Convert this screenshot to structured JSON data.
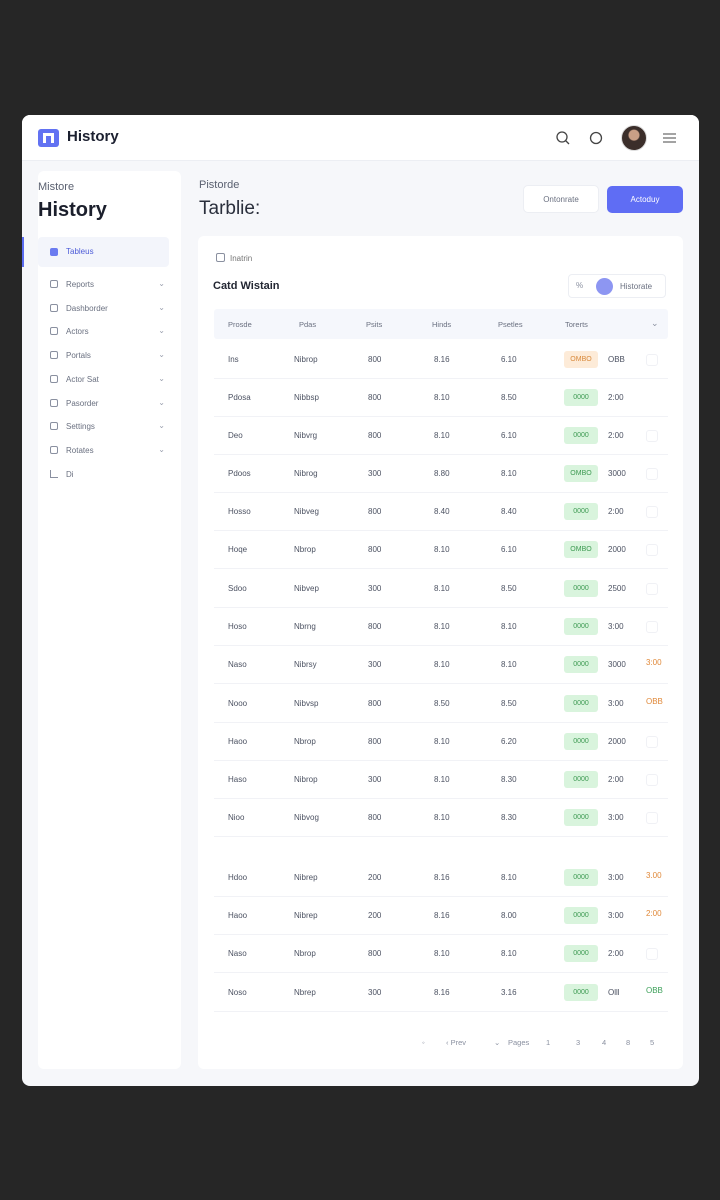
{
  "header": {
    "app_title": "History"
  },
  "sidebar": {
    "subtitle": "Mistore",
    "title": "History",
    "active_item": "Tableus",
    "items": [
      {
        "label": "Reports"
      },
      {
        "label": "Dashborder"
      },
      {
        "label": "Actors"
      },
      {
        "label": "Portals"
      },
      {
        "label": "Actor Sat"
      },
      {
        "label": "Pasorder"
      },
      {
        "label": "Settings"
      },
      {
        "label": "Rotates"
      }
    ],
    "footer_item": "Di"
  },
  "main": {
    "subtitle": "Pistorde",
    "title": "Tarblie:",
    "btn_secondary": "Ontonrate",
    "btn_primary": "Actoduy"
  },
  "card": {
    "search_placeholder": "Inatrin",
    "title": "Catd Wistain",
    "filter_icon": "%",
    "filter_label": "Historate"
  },
  "table": {
    "headers": [
      "Prosde",
      "Pdas",
      "Psits",
      "Hinds",
      "Psetles",
      "Torerts"
    ],
    "rows": [
      {
        "c1": "Ins",
        "c2": "Nibrop",
        "c3": "800",
        "c4": "8.16",
        "c5": "6.10",
        "status": "OMBO",
        "status_color": "orange",
        "value": "OBB",
        "extra": "",
        "extra_style": "box"
      },
      {
        "c1": "Pdosa",
        "c2": "Nibbsp",
        "c3": "800",
        "c4": "8.10",
        "c5": "8.50",
        "status": "0000",
        "status_color": "green",
        "value": "2:00",
        "extra": "",
        "extra_style": "none"
      },
      {
        "c1": "Deo",
        "c2": "Nibvrg",
        "c3": "800",
        "c4": "8.10",
        "c5": "6.10",
        "status": "0000",
        "status_color": "green",
        "value": "2:00",
        "extra": "",
        "extra_style": "box"
      },
      {
        "c1": "Pdoos",
        "c2": "Nibrog",
        "c3": "300",
        "c4": "8.80",
        "c5": "8.10",
        "status": "OMBO",
        "status_color": "green",
        "value": "3000",
        "extra": "",
        "extra_style": "box"
      },
      {
        "c1": "Hosso",
        "c2": "Nibveg",
        "c3": "800",
        "c4": "8.40",
        "c5": "8.40",
        "status": "0000",
        "status_color": "green",
        "value": "2:00",
        "extra": "",
        "extra_style": "box"
      },
      {
        "c1": "Hoqe",
        "c2": "Nbrop",
        "c3": "800",
        "c4": "8.10",
        "c5": "6.10",
        "status": "OMBO",
        "status_color": "green",
        "value": "2000",
        "extra": "",
        "extra_style": "box"
      },
      {
        "c1": "Sdoo",
        "c2": "Nibvep",
        "c3": "300",
        "c4": "8.10",
        "c5": "8.50",
        "status": "0000",
        "status_color": "green",
        "value": "2500",
        "extra": "",
        "extra_style": "box"
      },
      {
        "c1": "Hoso",
        "c2": "Nbrng",
        "c3": "800",
        "c4": "8.10",
        "c5": "8.10",
        "status": "0000",
        "status_color": "green",
        "value": "3:00",
        "extra": "",
        "extra_style": "box"
      },
      {
        "c1": "Naso",
        "c2": "Nibrsy",
        "c3": "300",
        "c4": "8.10",
        "c5": "8.10",
        "status": "0000",
        "status_color": "green",
        "value": "3000",
        "extra": "3:00",
        "extra_style": "orange"
      },
      {
        "c1": "Nooo",
        "c2": "Nibvsp",
        "c3": "800",
        "c4": "8.50",
        "c5": "8.50",
        "status": "0000",
        "status_color": "green",
        "value": "3:00",
        "extra": "OBB",
        "extra_style": "orange"
      },
      {
        "c1": "Haoo",
        "c2": "Nbrop",
        "c3": "800",
        "c4": "8.10",
        "c5": "6.20",
        "status": "0000",
        "status_color": "green",
        "value": "2000",
        "extra": "",
        "extra_style": "box"
      },
      {
        "c1": "Haso",
        "c2": "Nibrop",
        "c3": "300",
        "c4": "8.10",
        "c5": "8.30",
        "status": "0000",
        "status_color": "green",
        "value": "2:00",
        "extra": "",
        "extra_style": "box"
      },
      {
        "c1": "Nioo",
        "c2": "Nibvog",
        "c3": "800",
        "c4": "8.10",
        "c5": "8.30",
        "status": "0000",
        "status_color": "green",
        "value": "3:00",
        "extra": "",
        "extra_style": "box"
      },
      {
        "c1": "Hdoo",
        "c2": "Nibrep",
        "c3": "200",
        "c4": "8.16",
        "c5": "8.10",
        "status": "0000",
        "status_color": "green",
        "value": "3:00",
        "extra": "3.00",
        "extra_style": "orange"
      },
      {
        "c1": "Haoo",
        "c2": "Nibrep",
        "c3": "200",
        "c4": "8.16",
        "c5": "8.00",
        "status": "0000",
        "status_color": "green",
        "value": "3:00",
        "extra": "2:00",
        "extra_style": "orange"
      },
      {
        "c1": "Naso",
        "c2": "Nbrop",
        "c3": "800",
        "c4": "8.10",
        "c5": "8.10",
        "status": "0000",
        "status_color": "green",
        "value": "2:00",
        "extra": "",
        "extra_style": "box"
      },
      {
        "c1": "Noso",
        "c2": "Nbrep",
        "c3": "300",
        "c4": "8.16",
        "c5": "3.16",
        "status": "0000",
        "status_color": "green",
        "value": "Olll",
        "extra": "OBB",
        "extra_style": "green"
      }
    ]
  },
  "pagination": {
    "prev": "‹ Prev",
    "page_label": "Pages",
    "pages": [
      "1",
      "3",
      "4",
      "8",
      "5"
    ]
  }
}
